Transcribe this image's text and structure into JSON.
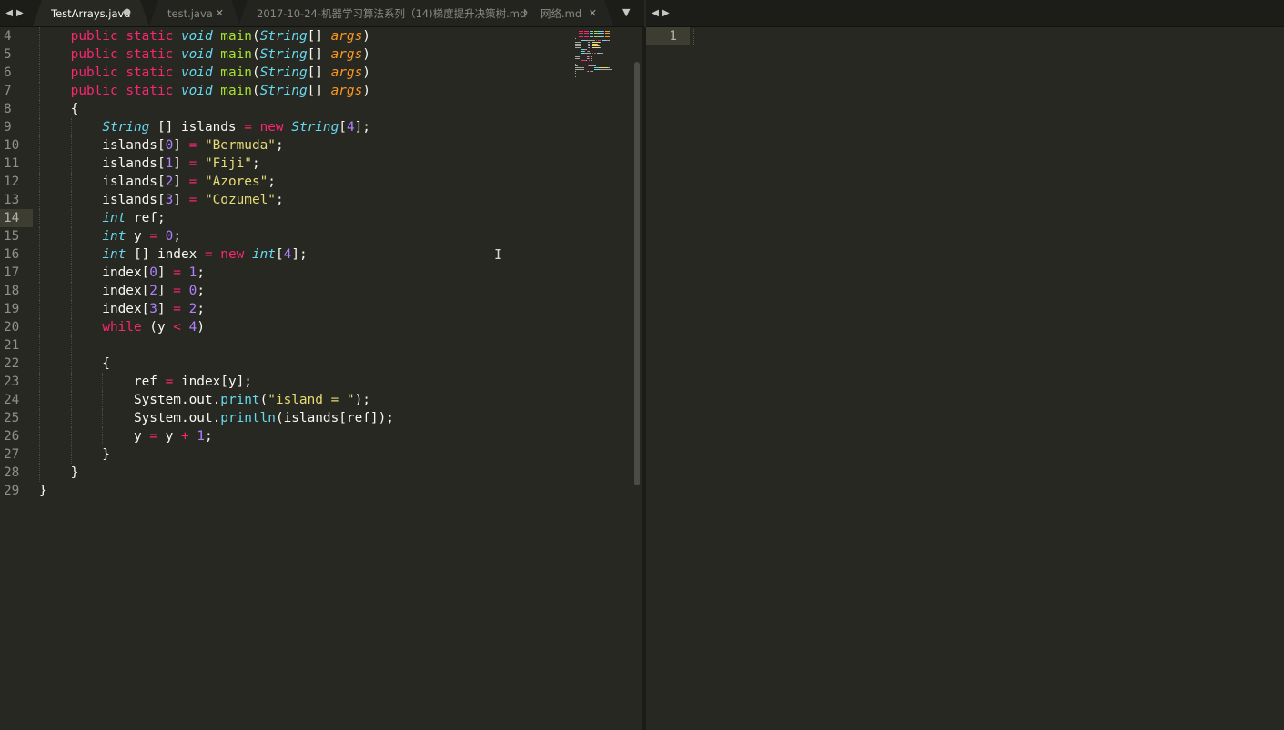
{
  "tabs": [
    {
      "label": "TestArrays.java",
      "active": true,
      "dirty": true
    },
    {
      "label": "test.java",
      "active": false,
      "dirty": false
    },
    {
      "label": "2017-10-24-机器学习算法系列（14)梯度提升决策树.md",
      "active": false,
      "dirty": false
    },
    {
      "label": "网络.md",
      "active": false,
      "dirty": false
    }
  ],
  "icons": {
    "nav_prev": "◀",
    "nav_next": "▶",
    "close": "✕",
    "dirty": "●",
    "dropdown": "▼",
    "ibeam": "I"
  },
  "editor": {
    "current_line": 14,
    "lines": [
      {
        "n": "4",
        "tokens": [
          [
            "    ",
            "pl"
          ],
          [
            "public",
            "kw"
          ],
          [
            " ",
            "pl"
          ],
          [
            "static",
            "kw"
          ],
          [
            " ",
            "pl"
          ],
          [
            "void",
            "st"
          ],
          [
            " ",
            "pl"
          ],
          [
            "main",
            "fn"
          ],
          [
            "(",
            "pl"
          ],
          [
            "String",
            "st"
          ],
          [
            "[] ",
            "pl"
          ],
          [
            "args",
            "pa"
          ],
          [
            ")",
            "pl"
          ]
        ]
      },
      {
        "n": "5",
        "tokens": [
          [
            "    ",
            "pl"
          ],
          [
            "public",
            "kw"
          ],
          [
            " ",
            "pl"
          ],
          [
            "static",
            "kw"
          ],
          [
            " ",
            "pl"
          ],
          [
            "void",
            "st"
          ],
          [
            " ",
            "pl"
          ],
          [
            "main",
            "fn"
          ],
          [
            "(",
            "pl"
          ],
          [
            "String",
            "st"
          ],
          [
            "[] ",
            "pl"
          ],
          [
            "args",
            "pa"
          ],
          [
            ")",
            "pl"
          ]
        ]
      },
      {
        "n": "6",
        "tokens": [
          [
            "    ",
            "pl"
          ],
          [
            "public",
            "kw"
          ],
          [
            " ",
            "pl"
          ],
          [
            "static",
            "kw"
          ],
          [
            " ",
            "pl"
          ],
          [
            "void",
            "st"
          ],
          [
            " ",
            "pl"
          ],
          [
            "main",
            "fn"
          ],
          [
            "(",
            "pl"
          ],
          [
            "String",
            "st"
          ],
          [
            "[] ",
            "pl"
          ],
          [
            "args",
            "pa"
          ],
          [
            ")",
            "pl"
          ]
        ]
      },
      {
        "n": "7",
        "tokens": [
          [
            "    ",
            "pl"
          ],
          [
            "public",
            "kw"
          ],
          [
            " ",
            "pl"
          ],
          [
            "static",
            "kw"
          ],
          [
            " ",
            "pl"
          ],
          [
            "void",
            "st"
          ],
          [
            " ",
            "pl"
          ],
          [
            "main",
            "fn"
          ],
          [
            "(",
            "pl"
          ],
          [
            "String",
            "st"
          ],
          [
            "[] ",
            "pl"
          ],
          [
            "args",
            "pa"
          ],
          [
            ")",
            "pl"
          ]
        ]
      },
      {
        "n": "8",
        "tokens": [
          [
            "    {",
            "pl"
          ]
        ]
      },
      {
        "n": "9",
        "tokens": [
          [
            "        ",
            "pl"
          ],
          [
            "String",
            "st"
          ],
          [
            " [] islands ",
            "pl"
          ],
          [
            "=",
            "op"
          ],
          [
            " ",
            "pl"
          ],
          [
            "new",
            "kw"
          ],
          [
            " ",
            "pl"
          ],
          [
            "String",
            "st"
          ],
          [
            "[",
            "pl"
          ],
          [
            "4",
            "nu"
          ],
          [
            "];",
            "pl"
          ]
        ]
      },
      {
        "n": "10",
        "tokens": [
          [
            "        islands[",
            "pl"
          ],
          [
            "0",
            "nu"
          ],
          [
            "] ",
            "pl"
          ],
          [
            "=",
            "op"
          ],
          [
            " ",
            "pl"
          ],
          [
            "\"Bermuda\"",
            "s"
          ],
          [
            ";",
            "pl"
          ]
        ]
      },
      {
        "n": "11",
        "tokens": [
          [
            "        islands[",
            "pl"
          ],
          [
            "1",
            "nu"
          ],
          [
            "] ",
            "pl"
          ],
          [
            "=",
            "op"
          ],
          [
            " ",
            "pl"
          ],
          [
            "\"Fiji\"",
            "s"
          ],
          [
            ";",
            "pl"
          ]
        ]
      },
      {
        "n": "12",
        "tokens": [
          [
            "        islands[",
            "pl"
          ],
          [
            "2",
            "nu"
          ],
          [
            "] ",
            "pl"
          ],
          [
            "=",
            "op"
          ],
          [
            " ",
            "pl"
          ],
          [
            "\"Azores\"",
            "s"
          ],
          [
            ";",
            "pl"
          ]
        ]
      },
      {
        "n": "13",
        "tokens": [
          [
            "        islands[",
            "pl"
          ],
          [
            "3",
            "nu"
          ],
          [
            "] ",
            "pl"
          ],
          [
            "=",
            "op"
          ],
          [
            " ",
            "pl"
          ],
          [
            "\"Cozumel\"",
            "s"
          ],
          [
            ";",
            "pl"
          ]
        ]
      },
      {
        "n": "14",
        "tokens": [
          [
            "        ",
            "pl"
          ],
          [
            "int",
            "st"
          ],
          [
            " ref;",
            "pl"
          ]
        ]
      },
      {
        "n": "15",
        "tokens": [
          [
            "        ",
            "pl"
          ],
          [
            "int",
            "st"
          ],
          [
            " y ",
            "pl"
          ],
          [
            "=",
            "op"
          ],
          [
            " ",
            "pl"
          ],
          [
            "0",
            "nu"
          ],
          [
            ";",
            "pl"
          ]
        ]
      },
      {
        "n": "16",
        "tokens": [
          [
            "        ",
            "pl"
          ],
          [
            "int",
            "st"
          ],
          [
            " [] index ",
            "pl"
          ],
          [
            "=",
            "op"
          ],
          [
            " ",
            "pl"
          ],
          [
            "new",
            "kw"
          ],
          [
            " ",
            "pl"
          ],
          [
            "int",
            "st"
          ],
          [
            "[",
            "pl"
          ],
          [
            "4",
            "nu"
          ],
          [
            "];",
            "pl"
          ]
        ]
      },
      {
        "n": "17",
        "tokens": [
          [
            "        index[",
            "pl"
          ],
          [
            "0",
            "nu"
          ],
          [
            "] ",
            "pl"
          ],
          [
            "=",
            "op"
          ],
          [
            " ",
            "pl"
          ],
          [
            "1",
            "nu"
          ],
          [
            ";",
            "pl"
          ]
        ]
      },
      {
        "n": "18",
        "tokens": [
          [
            "        index[",
            "pl"
          ],
          [
            "2",
            "nu"
          ],
          [
            "] ",
            "pl"
          ],
          [
            "=",
            "op"
          ],
          [
            " ",
            "pl"
          ],
          [
            "0",
            "nu"
          ],
          [
            ";",
            "pl"
          ]
        ]
      },
      {
        "n": "19",
        "tokens": [
          [
            "        index[",
            "pl"
          ],
          [
            "3",
            "nu"
          ],
          [
            "] ",
            "pl"
          ],
          [
            "=",
            "op"
          ],
          [
            " ",
            "pl"
          ],
          [
            "2",
            "nu"
          ],
          [
            ";",
            "pl"
          ]
        ]
      },
      {
        "n": "20",
        "tokens": [
          [
            "        ",
            "pl"
          ],
          [
            "while",
            "kw"
          ],
          [
            " (y ",
            "pl"
          ],
          [
            "<",
            "op"
          ],
          [
            " ",
            "pl"
          ],
          [
            "4",
            "nu"
          ],
          [
            ")",
            "pl"
          ]
        ]
      },
      {
        "n": "21",
        "tokens": []
      },
      {
        "n": "22",
        "tokens": [
          [
            "        {",
            "pl"
          ]
        ]
      },
      {
        "n": "23",
        "tokens": [
          [
            "            ref ",
            "pl"
          ],
          [
            "=",
            "op"
          ],
          [
            " index[y];",
            "pl"
          ]
        ]
      },
      {
        "n": "24",
        "tokens": [
          [
            "            System.out.",
            "pl"
          ],
          [
            "print",
            "bi"
          ],
          [
            "(",
            "pl"
          ],
          [
            "\"island = \"",
            "s"
          ],
          [
            ");",
            "pl"
          ]
        ]
      },
      {
        "n": "25",
        "tokens": [
          [
            "            System.out.",
            "pl"
          ],
          [
            "println",
            "bi"
          ],
          [
            "(islands[ref]);",
            "pl"
          ]
        ]
      },
      {
        "n": "26",
        "tokens": [
          [
            "            y ",
            "pl"
          ],
          [
            "=",
            "op"
          ],
          [
            " y ",
            "pl"
          ],
          [
            "+",
            "op"
          ],
          [
            " ",
            "pl"
          ],
          [
            "1",
            "nu"
          ],
          [
            ";",
            "pl"
          ]
        ]
      },
      {
        "n": "27",
        "tokens": [
          [
            "        }",
            "pl"
          ]
        ]
      },
      {
        "n": "28",
        "tokens": [
          [
            "    }",
            "pl"
          ]
        ]
      },
      {
        "n": "29",
        "tokens": [
          [
            "}",
            "pl"
          ]
        ]
      }
    ]
  },
  "right_pane": {
    "line_number": "1"
  },
  "colors": {
    "background": "#272822",
    "keyword": "#f92672",
    "type": "#66d9ef",
    "function": "#a6e22e",
    "parameter": "#fd971f",
    "number": "#ae81ff",
    "string": "#e6db74"
  }
}
